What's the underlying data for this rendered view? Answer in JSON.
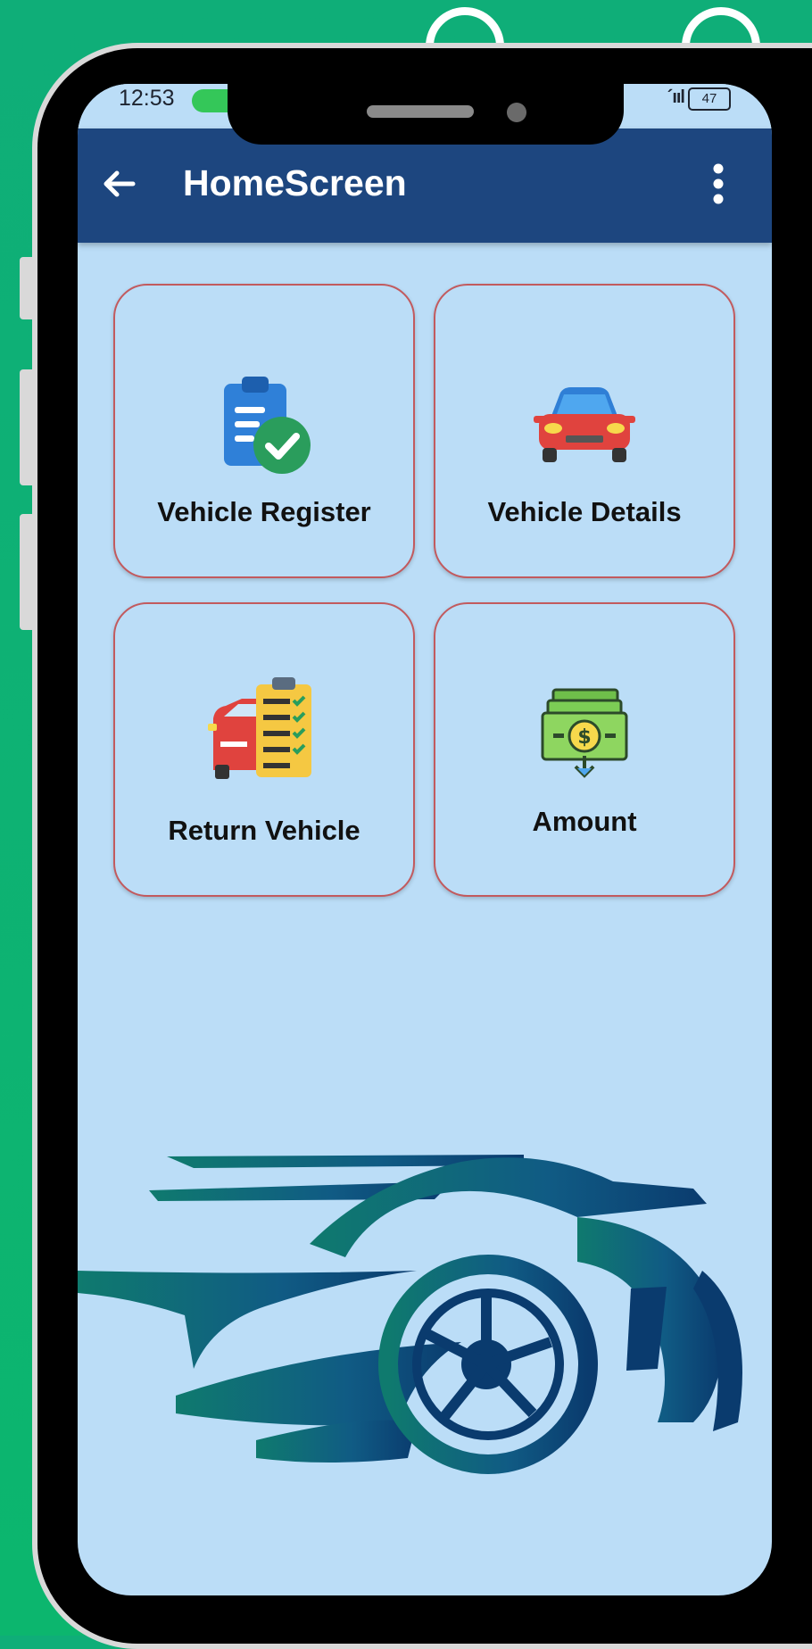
{
  "status_bar": {
    "time": "12:53",
    "signal": "´ııl",
    "battery": "47"
  },
  "app_bar": {
    "title": "HomeScreen",
    "back_icon": "arrow-back-icon",
    "menu_icon": "more-vert-icon",
    "color": "#1d467f"
  },
  "tiles": [
    {
      "label": "Vehicle Register",
      "icon": "clipboard-check-icon"
    },
    {
      "label": "Vehicle Details",
      "icon": "car-front-icon"
    },
    {
      "label": "Return Vehicle",
      "icon": "car-checklist-icon"
    },
    {
      "label": "Amount",
      "icon": "money-stack-icon"
    }
  ],
  "colors": {
    "screen_background": "#bbddf7",
    "tile_border": "#c25a5e",
    "frame_background": "#0fae78",
    "car_art": "#0e4d7a"
  }
}
